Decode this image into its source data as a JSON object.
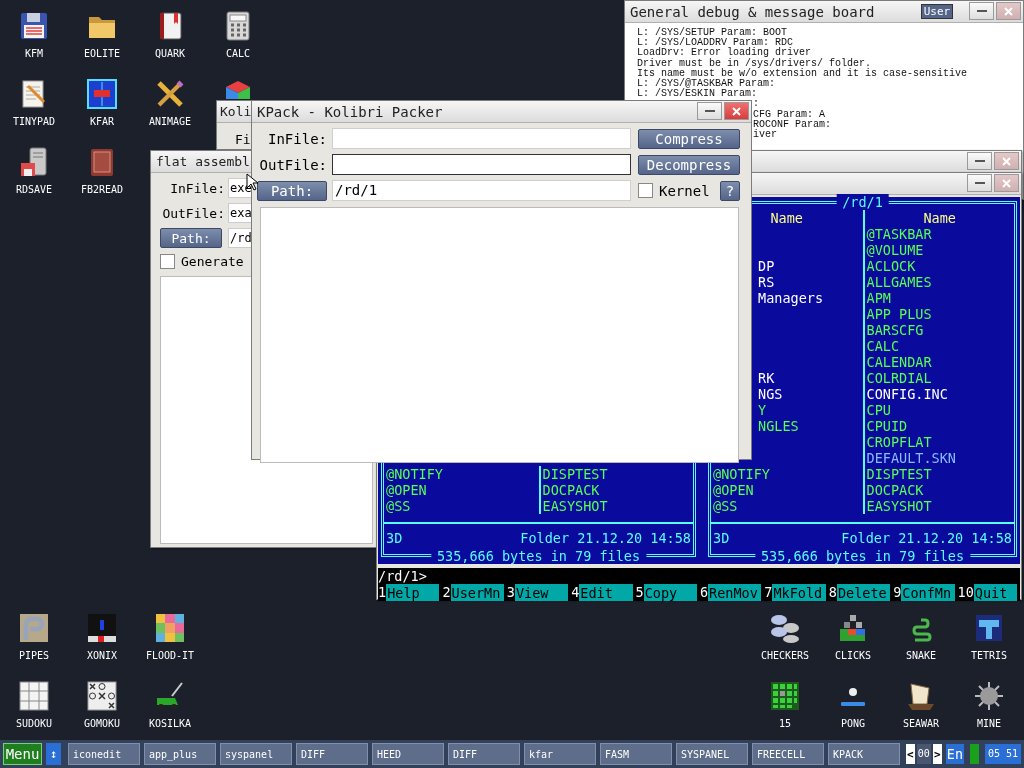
{
  "desktop_icons_top_left": [
    [
      {
        "label": "KFM",
        "kind": "floppy"
      },
      {
        "label": "EOLITE",
        "kind": "folder"
      },
      {
        "label": "QUARK",
        "kind": "book"
      },
      {
        "label": "CALC",
        "kind": "calculator"
      }
    ],
    [
      {
        "label": "TINYPAD",
        "kind": "notepad"
      },
      {
        "label": "KFAR",
        "kind": "panels"
      },
      {
        "label": "ANIMAGE",
        "kind": "pencil"
      },
      {
        "kind": "cube"
      }
    ],
    [
      {
        "label": "RDSAVE",
        "kind": "server"
      },
      {
        "label": "FB2READ",
        "kind": "redbook"
      }
    ]
  ],
  "desktop_icons_bottom_left": [
    [
      {
        "label": "PIPES",
        "kind": "pipes"
      },
      {
        "label": "XONIX",
        "kind": "xonix"
      },
      {
        "label": "FLOOD-IT",
        "kind": "flood"
      }
    ],
    [
      {
        "label": "SUDOKU",
        "kind": "sudoku"
      },
      {
        "label": "GOMOKU",
        "kind": "gomoku"
      },
      {
        "label": "KOSILKA",
        "kind": "mower"
      }
    ]
  ],
  "desktop_icons_bottom_right": [
    [
      {
        "label": "CHECKERS",
        "kind": "checkers"
      },
      {
        "label": "CLICKS",
        "kind": "clicks"
      },
      {
        "label": "SNAKE",
        "kind": "snake"
      },
      {
        "label": "TETRIS",
        "kind": "tetris"
      }
    ],
    [
      {
        "label": "15",
        "kind": "fifteen"
      },
      {
        "label": "PONG",
        "kind": "pong"
      },
      {
        "label": "SEAWAR",
        "kind": "ship"
      },
      {
        "label": "MINE",
        "kind": "mine"
      }
    ]
  ],
  "koli_window": {
    "title": "Koli",
    "text": "Fi"
  },
  "fasm_window": {
    "title": "flat assembl",
    "infile": {
      "label": "InFile:",
      "value": "exe"
    },
    "outfile": {
      "label": "OutFile:",
      "value": "exa"
    },
    "path": {
      "button": "Path:",
      "value": "/rd"
    },
    "generate": {
      "label": "Generate",
      "checked": false
    }
  },
  "debug_board": {
    "title": "General debug & message board",
    "user_button": "User",
    "lines": [
      "L: /SYS/SETUP Param: BOOT",
      "L: /SYS/LOADDRV Param: RDC",
      "LoadDrv: Error loading driver",
      "Driver must be in /sys/drivers/ folder.",
      "Its name must be w/o extension and it is case-sensitive",
      "L: /SYS/@TASKBAR Param:",
      "L: /SYS/ESKIN Param:"
    ],
    "partly_covered_lines": [
      ":",
      "CFG Param: A",
      "ROCONF Param:",
      "iver"
    ]
  },
  "kfar": {
    "panels": [
      {
        "rows": [
          {
            "name_1": {
              "text": "@NOTIFY",
              "color": "#55ff55"
            },
            "name_2": {
              "text": "DISPTEST",
              "color": "#55ff55"
            }
          },
          {
            "name_1": {
              "text": "@OPEN",
              "color": "#55ff55"
            },
            "name_2": {
              "text": "DOCPACK",
              "color": "#55ff55"
            }
          },
          {
            "name_1": {
              "text": "@SS",
              "color": "#55ff55"
            },
            "name_2": {
              "text": "EASYSHOT",
              "color": "#55ff55"
            }
          }
        ],
        "info_left": "3D",
        "info_right": "Folder 21.12.20 14:58",
        "totals": "535,666 bytes in 79 files"
      },
      {
        "title": "/rd/1",
        "headers": [
          "Name",
          "Name"
        ],
        "rows": [
          {
            "name_2": {
              "text": "@TASKBAR",
              "color": "#55ff55"
            }
          },
          {
            "name_2": {
              "text": "@VOLUME",
              "color": "#55ff55"
            }
          },
          {
            "name_1": {
              "text": "DP",
              "color": "#ffffff"
            },
            "name_2": {
              "text": "ACLOCK",
              "color": "#55ff55"
            }
          },
          {
            "name_1": {
              "text": "RS",
              "color": "#ffffff"
            },
            "name_2": {
              "text": "ALLGAMES",
              "color": "#55ff55"
            }
          },
          {
            "name_1": {
              "text": "Managers",
              "color": "#ffffff"
            },
            "name_2": {
              "text": "APM",
              "color": "#55ff55"
            }
          },
          {
            "name_2": {
              "text": "APP_PLUS",
              "color": "#55ff55"
            }
          },
          {
            "name_2": {
              "text": "BARSCFG",
              "color": "#55ff55"
            }
          },
          {
            "name_2": {
              "text": "CALC",
              "color": "#55ff55"
            }
          },
          {
            "name_2": {
              "text": "CALENDAR",
              "color": "#55ff55"
            }
          },
          {
            "name_1": {
              "text": "RK",
              "color": "#ffffff"
            },
            "name_2": {
              "text": "COLRDIAL",
              "color": "#55ff55"
            }
          },
          {
            "name_1": {
              "text": "NGS",
              "color": "#ffffff"
            },
            "name_2": {
              "text": "CONFIG.INC",
              "color": "#ffffff"
            }
          },
          {
            "name_1": {
              "text": "Y",
              "color": "#55ff55"
            },
            "name_2": {
              "text": "CPU",
              "color": "#55ff55"
            }
          },
          {
            "name_1": {
              "text": "NGLES",
              "color": "#55ff55"
            },
            "name_2": {
              "text": "CPUID",
              "color": "#55ff55"
            }
          },
          {
            "name_2": {
              "text": "CROPFLAT",
              "color": "#55ff55"
            }
          },
          {
            "name_2": {
              "text": "DEFAULT.SKN",
              "color": "#88bbff"
            }
          },
          {
            "name_1": {
              "text": "@NOTIFY",
              "color": "#55ff55"
            },
            "name_2": {
              "text": "DISPTEST",
              "color": "#55ff55"
            }
          },
          {
            "name_1": {
              "text": "@OPEN",
              "color": "#55ff55"
            },
            "name_2": {
              "text": "DOCPACK",
              "color": "#55ff55"
            }
          },
          {
            "name_1": {
              "text": "@SS",
              "color": "#55ff55"
            },
            "name_2": {
              "text": "EASYSHOT",
              "color": "#55ff55"
            }
          }
        ],
        "info_left": "3D",
        "info_right": "Folder 21.12.20 14:58",
        "totals": "535,666 bytes in 79 files"
      }
    ],
    "prompt": "/rd/1>",
    "function_keys": [
      {
        "key": "1",
        "label": "Help"
      },
      {
        "key": "2",
        "label": "UserMn"
      },
      {
        "key": "3",
        "label": "View"
      },
      {
        "key": "4",
        "label": "Edit"
      },
      {
        "key": "5",
        "label": "Copy"
      },
      {
        "key": "6",
        "label": "RenMov"
      },
      {
        "key": "7",
        "label": "MkFold"
      },
      {
        "key": "8",
        "label": "Delete"
      },
      {
        "key": "9",
        "label": "ConfMn"
      },
      {
        "key": "10",
        "label": "Quit"
      }
    ]
  },
  "kpack_window": {
    "title": "KPack - Kolibri Packer",
    "infile": {
      "label": "InFile:",
      "focused": false
    },
    "outfile": {
      "label": "OutFile:",
      "focused": true
    },
    "path": {
      "button": "Path:",
      "value": "/rd/1"
    },
    "compress": "Compress",
    "decompress": "Decompress",
    "kernel": {
      "label": "Kernel",
      "checked": false
    },
    "help": "?"
  },
  "taskbar": {
    "menu": "Menu",
    "switch": "↕",
    "tasks": [
      "iconedit",
      "app_plus",
      "syspanel",
      "DIFF",
      "HEED",
      "DIFF",
      "kfar",
      "FASM",
      "SYSPANEL",
      "FREECELL",
      "KPACK"
    ],
    "prev": "<",
    "page": "00",
    "next": ">",
    "language": "En",
    "clock": "05 51"
  }
}
